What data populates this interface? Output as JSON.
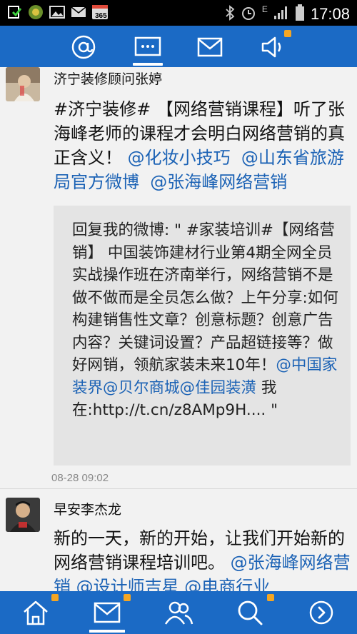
{
  "status_bar": {
    "time": "17:08",
    "network": "E",
    "app_badge": "365",
    "icons_left": [
      "download-icon",
      "app-icon",
      "image-icon",
      "message-icon",
      "calendar-365-icon"
    ],
    "icons_right": [
      "bluetooth-icon",
      "alarm-icon",
      "network-e-icon",
      "signal-icon",
      "battery-icon"
    ]
  },
  "top_tabs": [
    {
      "icon": "mention-icon",
      "active": false,
      "badge": false
    },
    {
      "icon": "comment-icon",
      "active": true,
      "badge": false
    },
    {
      "icon": "mail-icon",
      "active": false,
      "badge": false
    },
    {
      "icon": "speaker-icon",
      "active": false,
      "badge": true
    }
  ],
  "colors": {
    "brand_blue": "#1b6ac5",
    "link": "#1b62b5",
    "badge": "#f5a623",
    "quote_bg": "#e4e4e4"
  },
  "posts": [
    {
      "author": "济宁装修顾问张婷",
      "text_parts": [
        {
          "text": "#济宁装修# 【网络营销课程】听了张海峰老师的课程才会明白网络营销的真正含义！ ",
          "link": false
        },
        {
          "text": "@化妆小技巧",
          "link": true
        },
        {
          "text": "  ",
          "link": false
        },
        {
          "text": "@山东省旅游局官方微博",
          "link": true
        },
        {
          "text": "  ",
          "link": false
        },
        {
          "text": "@张海峰网络营销",
          "link": true
        }
      ],
      "quote_parts": [
        {
          "text": "回复我的微博: \" #家装培训#【网络营销】 中国装饰建材行业第4期全网全员实战操作班在济南举行，网络营销不是做不做而是全员怎么做？上午分享:如何构建销售性文章？创意标题？创意广告内容？关键词设置？产品超链接等？做好网销，领航家装未来10年！",
          "link": false
        },
        {
          "text": "@中国家装界",
          "link": true
        },
        {
          "text": "@贝尔商城",
          "link": true
        },
        {
          "text": "@佳园装潢",
          "link": true
        },
        {
          "text": " 我在:http://t.cn/z8AMp9H....  \"",
          "link": false
        }
      ],
      "timestamp": "08-28 09:02"
    },
    {
      "author": "早安李杰龙",
      "text_parts": [
        {
          "text": "新的一天，新的开始，让我们开始新的网络营销课程培训吧。 ",
          "link": false
        },
        {
          "text": "@张海峰网络营销",
          "link": true
        },
        {
          "text": " ",
          "link": false
        },
        {
          "text": "@设计师吉星",
          "link": true
        },
        {
          "text": " ",
          "link": false
        },
        {
          "text": "@电商行业",
          "link": true
        }
      ]
    }
  ],
  "bottom_nav": [
    {
      "icon": "home-icon",
      "badge": true,
      "active": false
    },
    {
      "icon": "mail-icon",
      "badge": true,
      "active": true
    },
    {
      "icon": "contacts-icon",
      "badge": false,
      "active": false
    },
    {
      "icon": "search-icon",
      "badge": true,
      "active": false
    },
    {
      "icon": "more-arrow-icon",
      "badge": false,
      "active": false
    }
  ]
}
